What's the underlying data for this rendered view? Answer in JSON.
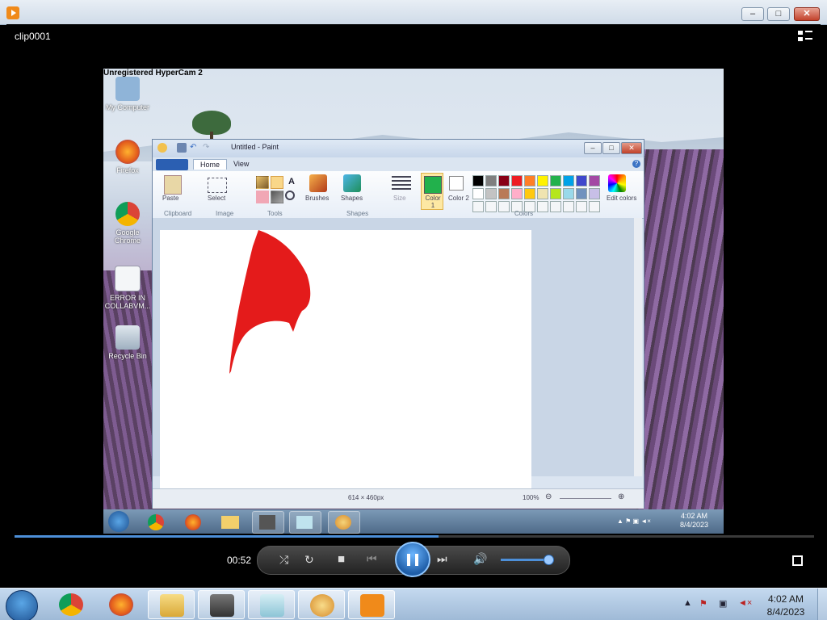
{
  "player": {
    "clip_title": "clip0001",
    "elapsed": "00:52",
    "progress_fraction": 0.53,
    "volume_fraction": 0.9,
    "window_buttons": {
      "minimize": "–",
      "maximize": "□",
      "close": "✕"
    }
  },
  "video": {
    "watermark": "Unregistered HyperCam 2",
    "desktop_icons": [
      {
        "label": "My Computer"
      },
      {
        "label": "Firefox"
      },
      {
        "label": "Google Chrome"
      },
      {
        "label": "ERROR IN COLLABVM..."
      },
      {
        "label": "Recycle Bin"
      }
    ],
    "paint": {
      "title": "Untitled - Paint",
      "tabs": [
        "Home",
        "View"
      ],
      "groups": {
        "clipboard": "Clipboard",
        "image": "Image",
        "tools": "Tools",
        "shapes": "Shapes",
        "colors": "Colors"
      },
      "buttons": {
        "paste": "Paste",
        "select": "Select",
        "brushes": "Brushes",
        "shapes": "Shapes",
        "size": "Size",
        "color1": "Color 1",
        "color2": "Color 2",
        "edit_colors": "Edit colors"
      },
      "active_color": "#22b14c",
      "palette_row1": [
        "#000000",
        "#7f7f7f",
        "#880015",
        "#ed1c24",
        "#ff7f27",
        "#fff200",
        "#22b14c",
        "#00a2e8",
        "#3f48cc",
        "#a349a4"
      ],
      "palette_row2": [
        "#ffffff",
        "#c3c3c3",
        "#b97a57",
        "#ffaec9",
        "#ffc90e",
        "#efe4b0",
        "#b5e61d",
        "#99d9ea",
        "#7092be",
        "#c8bfe7"
      ],
      "drawn_shape_color": "#e41b1b",
      "status": {
        "size": "614 × 460px",
        "zoom": "100%"
      }
    },
    "inner_clock": {
      "time": "4:02 AM",
      "date": "8/4/2023"
    }
  },
  "taskbar": {
    "clock": {
      "time": "4:02 AM",
      "date": "8/4/2023"
    },
    "pinned": [
      "chrome-icon",
      "firefox-icon",
      "explorer-icon",
      "hypercam-icon",
      "notepad-icon",
      "paint-icon",
      "media-player-icon"
    ]
  }
}
